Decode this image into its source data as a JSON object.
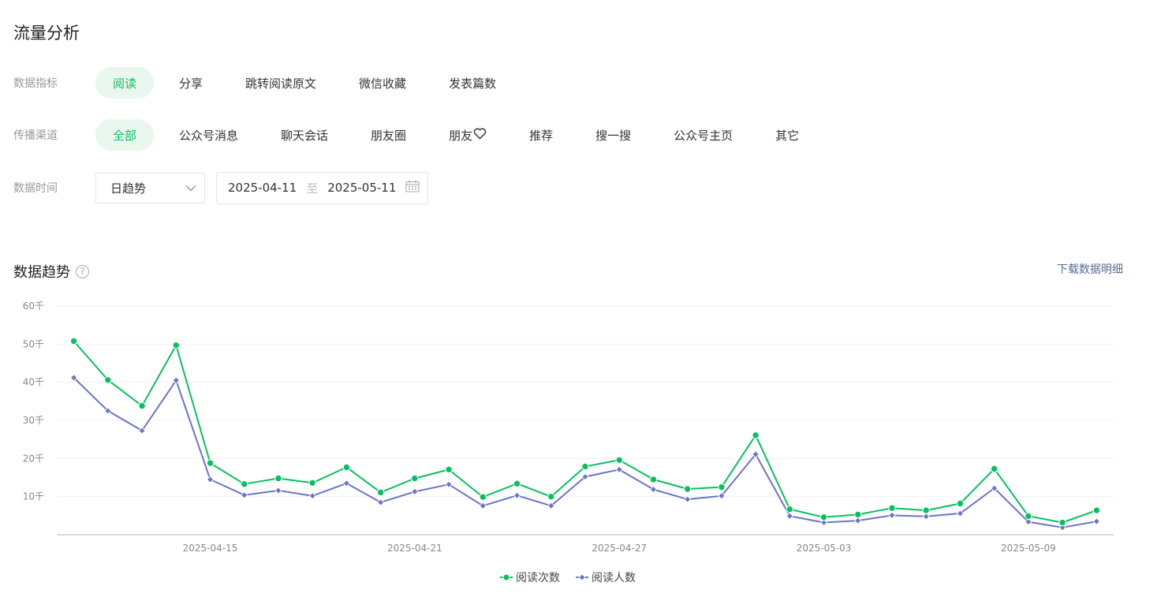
{
  "page": {
    "title": "流量分析"
  },
  "filters": {
    "metric": {
      "label": "数据指标",
      "options": [
        "阅读",
        "分享",
        "跳转阅读原文",
        "微信收藏",
        "发表篇数"
      ],
      "active": 0
    },
    "channel": {
      "label": "传播渠道",
      "options": [
        "全部",
        "公众号消息",
        "聊天会话",
        "朋友圈",
        "朋友",
        "推荐",
        "搜一搜",
        "公众号主页",
        "其它"
      ],
      "active": 0,
      "heart_after_index": 4
    },
    "time": {
      "label": "数据时间",
      "granularity": "日趋势",
      "start": "2025-04-11",
      "sep": "至",
      "end": "2025-05-11"
    }
  },
  "section": {
    "title": "数据趋势",
    "help": "?",
    "download": "下载数据明细"
  },
  "colors": {
    "accent": "#07c160",
    "accent_bg": "#e9f7ef",
    "series1": "#07c160",
    "series2": "#6b74c8",
    "link": "#576b95"
  },
  "chart_data": {
    "type": "line",
    "x": [
      "2025-04-11",
      "2025-04-12",
      "2025-04-13",
      "2025-04-14",
      "2025-04-15",
      "2025-04-16",
      "2025-04-17",
      "2025-04-18",
      "2025-04-19",
      "2025-04-20",
      "2025-04-21",
      "2025-04-22",
      "2025-04-23",
      "2025-04-24",
      "2025-04-25",
      "2025-04-26",
      "2025-04-27",
      "2025-04-28",
      "2025-04-29",
      "2025-04-30",
      "2025-05-01",
      "2025-05-02",
      "2025-05-03",
      "2025-05-04",
      "2025-05-05",
      "2025-05-06",
      "2025-05-07",
      "2025-05-08",
      "2025-05-09",
      "2025-05-10",
      "2025-05-11"
    ],
    "xticks": [
      "2025-04-15",
      "2025-04-21",
      "2025-04-27",
      "2025-05-03",
      "2025-05-09"
    ],
    "ytick_labels": [
      "10千",
      "20千",
      "30千",
      "40千",
      "50千",
      "60千"
    ],
    "yticks": [
      10000,
      20000,
      30000,
      40000,
      50000,
      60000
    ],
    "ylim": [
      0,
      60000
    ],
    "grid": true,
    "legend_position": "bottom",
    "series": [
      {
        "name": "阅读次数",
        "marker": "circle",
        "values": [
          50800,
          40600,
          33800,
          49700,
          18800,
          13300,
          14800,
          13600,
          17700,
          11100,
          14800,
          17100,
          9900,
          13400,
          10000,
          17900,
          19600,
          14500,
          12000,
          12500,
          26100,
          6700,
          4600,
          5300,
          7000,
          6400,
          8200,
          17300,
          4900,
          3200,
          6400
        ]
      },
      {
        "name": "阅读人数",
        "marker": "diamond",
        "values": [
          41200,
          32500,
          27300,
          40500,
          14500,
          10400,
          11600,
          10200,
          13500,
          8500,
          11300,
          13200,
          7600,
          10300,
          7600,
          15200,
          17100,
          11900,
          9300,
          10200,
          21100,
          4900,
          3200,
          3700,
          5100,
          4800,
          5600,
          12200,
          3400,
          1900,
          3500
        ]
      }
    ]
  }
}
